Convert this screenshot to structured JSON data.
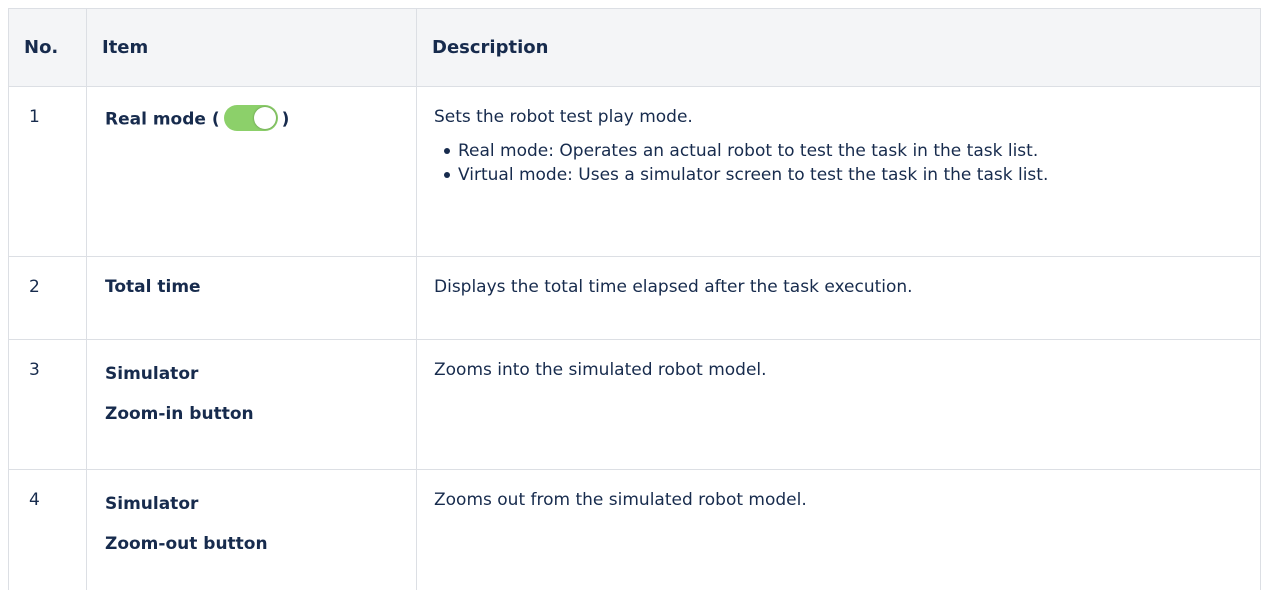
{
  "table": {
    "headers": {
      "no": "No.",
      "item": "Item",
      "description": "Description"
    },
    "rows": [
      {
        "no": "1",
        "item_prefix": "Real mode (",
        "item_suffix": ")",
        "toggle_icon": "toggle-on-icon",
        "description": "Sets the robot test play mode.",
        "bullets": [
          "Real mode: Operates an actual robot to test the task in the task list.",
          "Virtual mode: Uses a simulator screen to test the task in the task list."
        ]
      },
      {
        "no": "2",
        "item": "Total time",
        "description": "Displays the total time elapsed after the task execution."
      },
      {
        "no": "3",
        "item_line1": "Simulator",
        "item_line2": "Zoom-in button",
        "description": "Zooms into the simulated robot model."
      },
      {
        "no": "4",
        "item_line1": "Simulator",
        "item_line2": "Zoom-out button",
        "description": "Zooms out from the simulated robot model."
      }
    ]
  },
  "colors": {
    "header_background": "#f4f5f7",
    "border": "#dcdfe4",
    "toggle_on": "#8cd06a",
    "text": "#172b4d"
  }
}
